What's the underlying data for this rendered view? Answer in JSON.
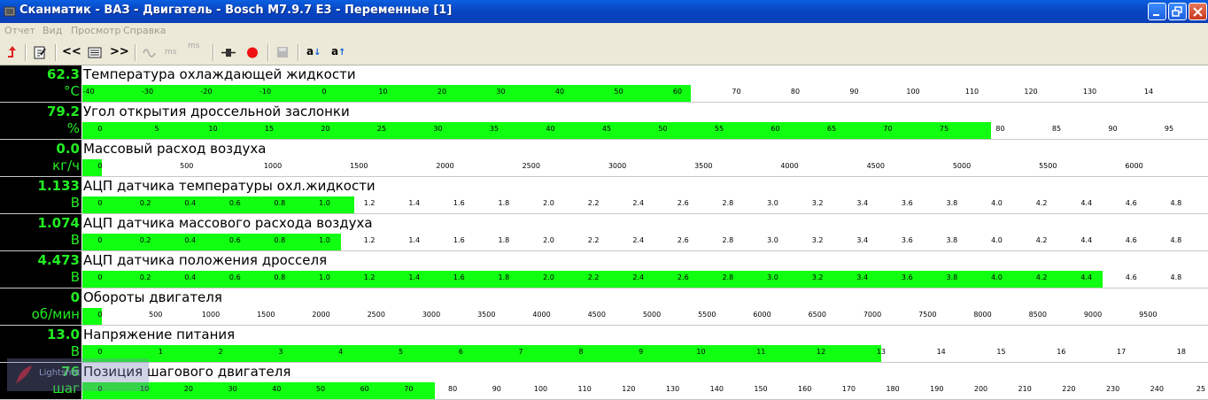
{
  "window": {
    "title": "Сканматик - ВАЗ - Двигатель - Bosch M7.9.7 E3 - Переменные [1]"
  },
  "menu": [
    "Отчет",
    "Вид",
    "Просмотр",
    "Справка"
  ],
  "toolbar": {
    "prev_label": "<<",
    "next_label": ">>",
    "ms_minus_label": "ms",
    "ms_plus_label": "ms",
    "sort_asc_label": "a",
    "sort_desc_label": "a"
  },
  "colors": {
    "bar": "#11ff11",
    "value": "#22ee22",
    "titlebar": "#0a50d8"
  },
  "parameters": [
    {
      "name": "Температура охлаждающей жидкости",
      "value": "62.3",
      "unit": "°C",
      "min": -50,
      "max": 140,
      "current": 62.3,
      "ticks": [
        "-40",
        "-30",
        "-20",
        "-10",
        "0",
        "10",
        "20",
        "30",
        "40",
        "50",
        "60",
        "70",
        "80",
        "90",
        "100",
        "110",
        "120",
        "130",
        "14"
      ]
    },
    {
      "name": "Угол открытия дроссельной заслонки",
      "value": "79.2",
      "unit": "%",
      "min": 0,
      "max": 100,
      "current": 79.2,
      "ticks": [
        "0",
        "5",
        "10",
        "15",
        "20",
        "25",
        "30",
        "35",
        "40",
        "45",
        "50",
        "55",
        "60",
        "65",
        "70",
        "75",
        "80",
        "85",
        "90",
        "95"
      ]
    },
    {
      "name": "Массовый расход воздуха",
      "value": "0.0",
      "unit": "кг/ч",
      "min": 0,
      "max": 6400,
      "current": 0,
      "ticks": [
        "0",
        "500",
        "1000",
        "1500",
        "2000",
        "2500",
        "3000",
        "3500",
        "4000",
        "4500",
        "5000",
        "5500",
        "6000"
      ]
    },
    {
      "name": "АЦП датчика температуры охл.жидкости",
      "value": "1.133",
      "unit": "В",
      "min": 0,
      "max": 5,
      "current": 1.133,
      "ticks": [
        "0",
        "0.2",
        "0.4",
        "0.6",
        "0.8",
        "1.0",
        "1.2",
        "1.4",
        "1.6",
        "1.8",
        "2.0",
        "2.2",
        "2.4",
        "2.6",
        "2.8",
        "3.0",
        "3.2",
        "3.4",
        "3.6",
        "3.8",
        "4.0",
        "4.2",
        "4.4",
        "4.6",
        "4.8"
      ]
    },
    {
      "name": "АЦП датчика массового расхода воздуха",
      "value": "1.074",
      "unit": "В",
      "min": 0,
      "max": 5,
      "current": 1.074,
      "ticks": [
        "0",
        "0.2",
        "0.4",
        "0.6",
        "0.8",
        "1.0",
        "1.2",
        "1.4",
        "1.6",
        "1.8",
        "2.0",
        "2.2",
        "2.4",
        "2.6",
        "2.8",
        "3.0",
        "3.2",
        "3.4",
        "3.6",
        "3.8",
        "4.0",
        "4.2",
        "4.4",
        "4.6",
        "4.8"
      ]
    },
    {
      "name": "АЦП датчика положения дросселя",
      "value": "4.473",
      "unit": "В",
      "min": 0,
      "max": 5,
      "current": 4.473,
      "ticks": [
        "0",
        "0.2",
        "0.4",
        "0.6",
        "0.8",
        "1.0",
        "1.2",
        "1.4",
        "1.6",
        "1.8",
        "2.0",
        "2.2",
        "2.4",
        "2.6",
        "2.8",
        "3.0",
        "3.2",
        "3.4",
        "3.6",
        "3.8",
        "4.0",
        "4.2",
        "4.4",
        "4.6",
        "4.8"
      ]
    },
    {
      "name": "Обороты двигателя",
      "value": "0",
      "unit": "об/мин",
      "min": 0,
      "max": 10000,
      "current": 0,
      "ticks": [
        "0",
        "500",
        "1000",
        "1500",
        "2000",
        "2500",
        "3000",
        "3500",
        "4000",
        "4500",
        "5000",
        "5500",
        "6000",
        "6500",
        "7000",
        "7500",
        "8000",
        "8500",
        "9000",
        "9500"
      ]
    },
    {
      "name": "Напряжение питания",
      "value": "13.0",
      "unit": "В",
      "min": 0,
      "max": 18.7,
      "current": 13.0,
      "ticks": [
        "0",
        "1",
        "2",
        "3",
        "4",
        "5",
        "6",
        "7",
        "8",
        "9",
        "10",
        "11",
        "12",
        "13",
        "14",
        "15",
        "16",
        "17",
        "18"
      ]
    },
    {
      "name": "Позиция шагового двигателя",
      "value": "76",
      "unit": "шаг",
      "min": 0,
      "max": 252,
      "current": 76,
      "ticks": [
        "0",
        "10",
        "20",
        "30",
        "40",
        "50",
        "60",
        "70",
        "80",
        "90",
        "100",
        "110",
        "120",
        "130",
        "140",
        "150",
        "160",
        "170",
        "180",
        "190",
        "200",
        "210",
        "220",
        "230",
        "240",
        "25"
      ]
    }
  ],
  "watermark": {
    "text": "Lightshot"
  }
}
